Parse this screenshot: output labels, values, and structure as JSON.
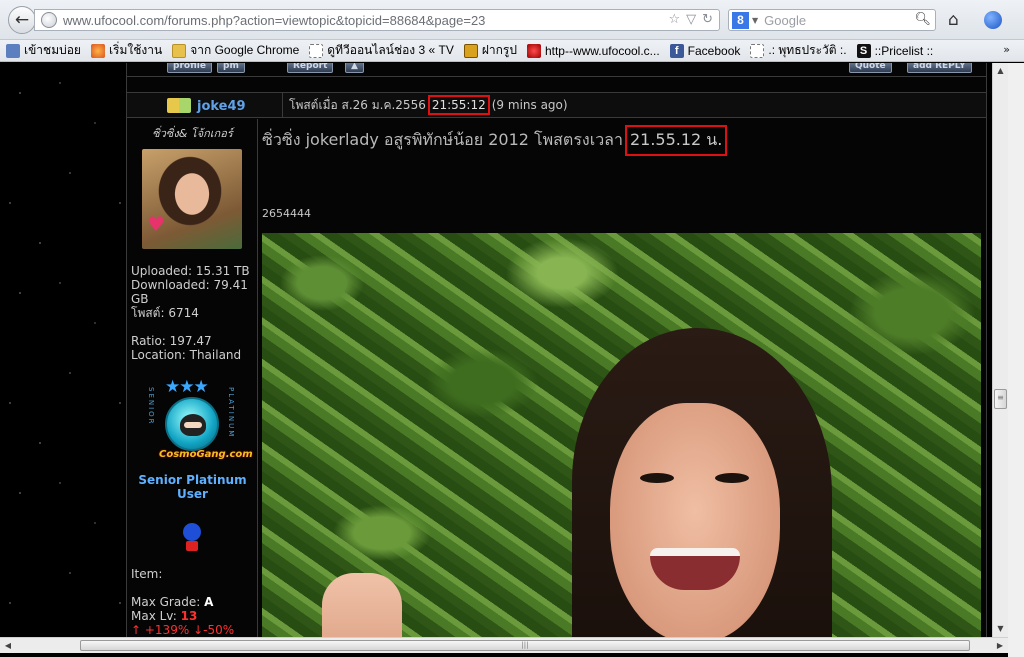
{
  "browser": {
    "url": "www.ufocool.com/forums.php?action=viewtopic&topicid=88684&page=23",
    "search_engine_letter": "8",
    "search_placeholder": "Google",
    "bookmarks": [
      {
        "label": "เข้าชมบ่อย",
        "icon": "pin-icon"
      },
      {
        "label": "เริ่มใช้งาน",
        "icon": "firefox-icon"
      },
      {
        "label": "จาก Google Chrome",
        "icon": "folder-icon"
      },
      {
        "label": "ดูทีวีออนไลน์ช่อง 3 « TV",
        "icon": "page-icon"
      },
      {
        "label": "ฝากรูป",
        "icon": "tz-icon"
      },
      {
        "label": "http--www.ufocool.c...",
        "icon": "ufo-icon"
      },
      {
        "label": "Facebook",
        "icon": "facebook-icon"
      },
      {
        "label": ".: พุทธประวัติ :.",
        "icon": "page-icon"
      },
      {
        "label": "::Pricelist ::",
        "icon": "s-icon"
      }
    ],
    "more_chevron": "»"
  },
  "forum": {
    "prev_buttons": {
      "profile": "profile",
      "pm": "pm",
      "report": "Report",
      "top": "▲",
      "quote": "Quote",
      "add_reply": "add REPLY"
    },
    "post": {
      "author": "joke49",
      "meta_prefix": "โพสต์เมื่อ ส.26 ม.ค.2556",
      "meta_time": "21:55:12",
      "meta_suffix": "(9 mins ago)",
      "user_title": "ซิ่วซิ่ง& โจ้กเกอร์",
      "stats": {
        "uploaded": "Uploaded: 15.31 TB",
        "downloaded": "Downloaded: 79.41 GB",
        "posts": "โพสต์: 6714",
        "ratio": "Ratio: 197.47",
        "location": "Location: Thailand"
      },
      "rank_logo": "CosmoGang",
      "rank_logo_sub": ".com",
      "rank_side_left": "SENIOR",
      "rank_side_right": "PLATINUM",
      "rank_name": "Senior Platinum User",
      "item_label": "Item:",
      "max_grade_label": "Max Grade:",
      "max_grade_value": "A",
      "max_lv_label": "Max Lv:",
      "max_lv_value": "13",
      "boost_up": "↑ +139%",
      "boost_down": "↓-50%",
      "title_prefix": "ซิ่วซิ่ง jokerlady อสูรพิทักษ์น้อย 2012 โพสตรงเวลา",
      "title_time": "21.55.12 น.",
      "code": "2654444"
    }
  }
}
